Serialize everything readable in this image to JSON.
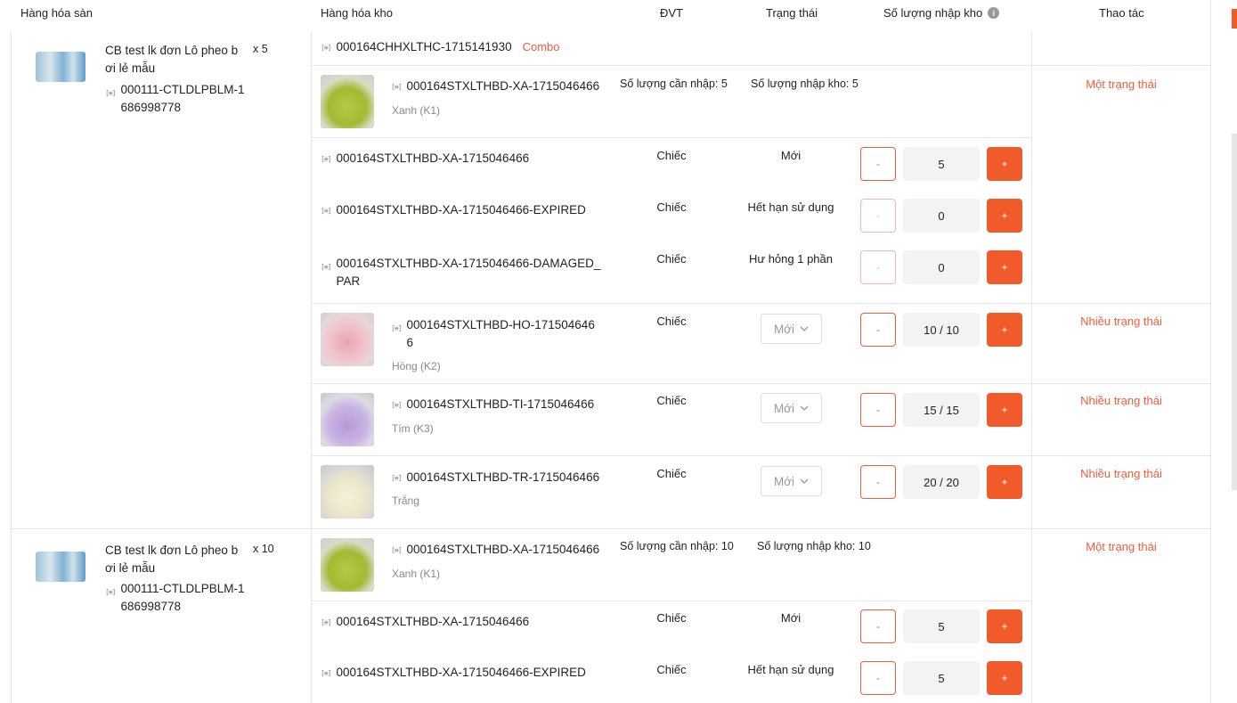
{
  "header": {
    "col_platform": "Hàng hóa sàn",
    "col_warehouse": "Hàng hóa kho",
    "col_unit": "ĐVT",
    "col_status": "Trạng thái",
    "col_qty": "Số lượng nhập kho",
    "col_action": "Thao tác"
  },
  "icons": {
    "barcode": "[≡]",
    "info": "i",
    "chevron": "chevron-down-icon"
  },
  "colors": {
    "accent": "#f15a29",
    "accent_text": "#f05d38"
  },
  "group1": {
    "platform_name": "CB test lk đơn Lô pheo b ơi lẻ mẫu",
    "platform_qty": "x 5",
    "platform_sku": "000111-CTLDLPBLM-1686998778",
    "combo_sku": "000164CHHXLTHC-1715141930",
    "combo_tag": "Combo",
    "item1": {
      "sku": "000164STXLTHBD-XA-1715046466",
      "variant": "Xanh (K1)",
      "need": "Số lượng cần nhập: 5",
      "stock": "Số lượng nhập kho: 5",
      "action": "Một trạng thái",
      "rows": [
        {
          "sku": "000164STXLTHBD-XA-1715046466",
          "unit": "Chiếc",
          "status": "Mới",
          "minus": "-",
          "value": "5",
          "plus": "+"
        },
        {
          "sku": "000164STXLTHBD-XA-1715046466-EXPIRED",
          "unit": "Chiếc",
          "status": "Hết hạn sử dụng",
          "minus": "-",
          "value": "0",
          "plus": "+"
        },
        {
          "sku": "000164STXLTHBD-XA-1715046466-DAMAGED_PAR",
          "unit": "Chiếc",
          "status": "Hư hỏng 1 phần",
          "minus": "-",
          "value": "0",
          "plus": "+"
        }
      ]
    },
    "item2": {
      "sku": "000164STXLTHBD-HO-1715046466",
      "variant": "Hồng (K2)",
      "unit": "Chiếc",
      "status": "Mới",
      "minus": "-",
      "value": "10 / 10",
      "plus": "+",
      "action": "Nhiều trạng thái"
    },
    "item3": {
      "sku": "000164STXLTHBD-TI-1715046466",
      "variant": "Tím (K3)",
      "unit": "Chiếc",
      "status": "Mới",
      "minus": "-",
      "value": "15 / 15",
      "plus": "+",
      "action": "Nhiều trạng thái"
    },
    "item4": {
      "sku": "000164STXLTHBD-TR-1715046466",
      "variant": "Trắng",
      "unit": "Chiếc",
      "status": "Mới",
      "minus": "-",
      "value": "20 / 20",
      "plus": "+",
      "action": "Nhiều trạng thái"
    }
  },
  "group2": {
    "platform_name": "CB test lk đơn Lô pheo b ơi lẻ mẫu",
    "platform_qty": "x 10",
    "platform_sku": "000111-CTLDLPBLM-1686998778",
    "item1": {
      "sku": "000164STXLTHBD-XA-1715046466",
      "variant": "Xanh (K1)",
      "need": "Số lượng cần nhập: 10",
      "stock": "Số lượng nhập kho: 10",
      "action": "Một trạng thái",
      "rows": [
        {
          "sku": "000164STXLTHBD-XA-1715046466",
          "unit": "Chiếc",
          "status": "Mới",
          "minus": "-",
          "value": "5",
          "plus": "+"
        },
        {
          "sku": "000164STXLTHBD-XA-1715046466-EXPIRED",
          "unit": "Chiếc",
          "status": "Hết hạn sử dụng",
          "minus": "-",
          "value": "5",
          "plus": "+"
        }
      ]
    }
  }
}
